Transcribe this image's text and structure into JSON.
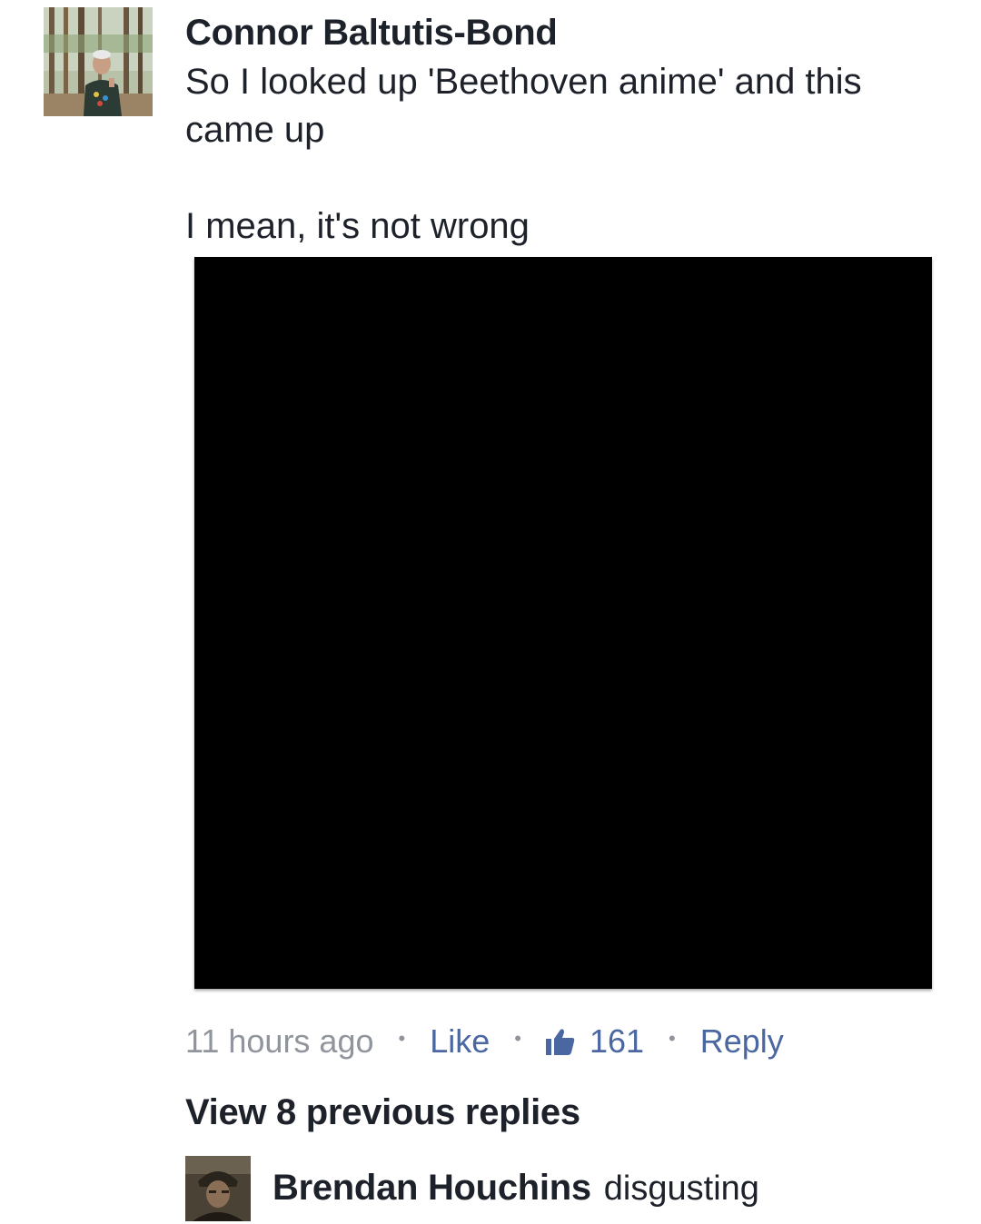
{
  "comment": {
    "author": "Connor Baltutis-Bond",
    "text_lines": [
      "So I looked up 'Beethoven anime' and this",
      "came up",
      "",
      "I mean, it's not wrong"
    ],
    "image_description_alt": "attached image",
    "time": "11 hours ago",
    "like_label": "Like",
    "like_count": "161",
    "reply_label": "Reply",
    "separator": "•"
  },
  "replies": {
    "view_previous_label": "View 8 previous replies",
    "latest": {
      "author": "Brendan Houchins",
      "text": "disgusting"
    }
  },
  "colors": {
    "text": "#1d2129",
    "meta_gray": "#90949c",
    "link_blue": "#4b67a1",
    "image_bg": "#000000"
  },
  "icons": {
    "like_count_icon": "thumbs-up-icon"
  }
}
